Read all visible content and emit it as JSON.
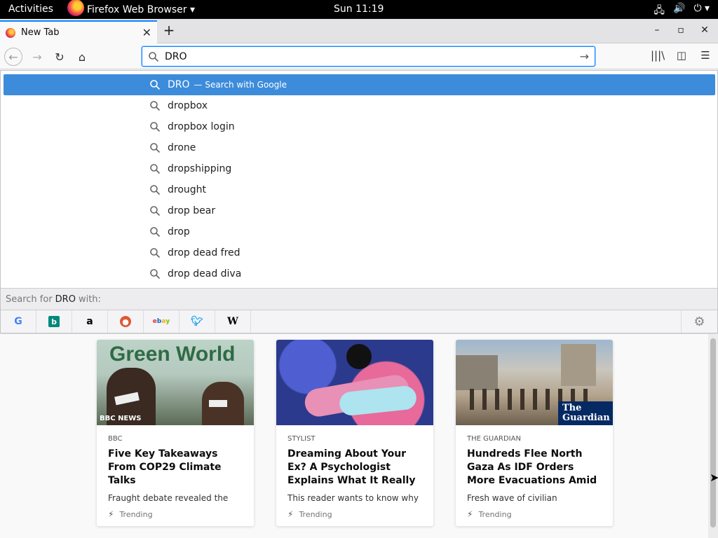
{
  "topbar": {
    "activities": "Activities",
    "app_menu": "Firefox Web Browser ▾",
    "clock": "Sun 11:19"
  },
  "tab": {
    "title": "New Tab"
  },
  "urlbar": {
    "value": "DRO"
  },
  "suggestions": {
    "first": {
      "query": "DRO",
      "action": "— Search with Google"
    },
    "items": [
      "dropbox",
      "dropbox login",
      "drone",
      "dropshipping",
      "drought",
      "drop bear",
      "drop",
      "drop dead fred",
      "drop dead diva"
    ]
  },
  "oneoff": {
    "prefix": "Search for",
    "query": "DRO",
    "suffix": "with:",
    "engines": [
      "google",
      "bing",
      "amazon",
      "duckduckgo",
      "ebay",
      "twitter",
      "wikipedia"
    ]
  },
  "cards": [
    {
      "source": "BBC",
      "headline": "Five Key Takeaways From COP29 Climate Talks",
      "excerpt": "Fraught debate revealed the",
      "context": "Trending",
      "thumb_text": "Green World",
      "brand": "BBC NEWS"
    },
    {
      "source": "STYLIST",
      "headline": "Dreaming About Your Ex? A Psychologist Explains What It Really",
      "excerpt": "This reader wants to know why",
      "context": "Trending"
    },
    {
      "source": "THE GUARDIAN",
      "headline": "Hundreds Flee North Gaza As IDF Orders More Evacuations Amid",
      "excerpt": "Fresh wave of civilian",
      "context": "Trending",
      "brand": "The Guardian"
    }
  ],
  "colors": {
    "accent": "#0a84ff",
    "selected_row": "#3d8cdb"
  }
}
